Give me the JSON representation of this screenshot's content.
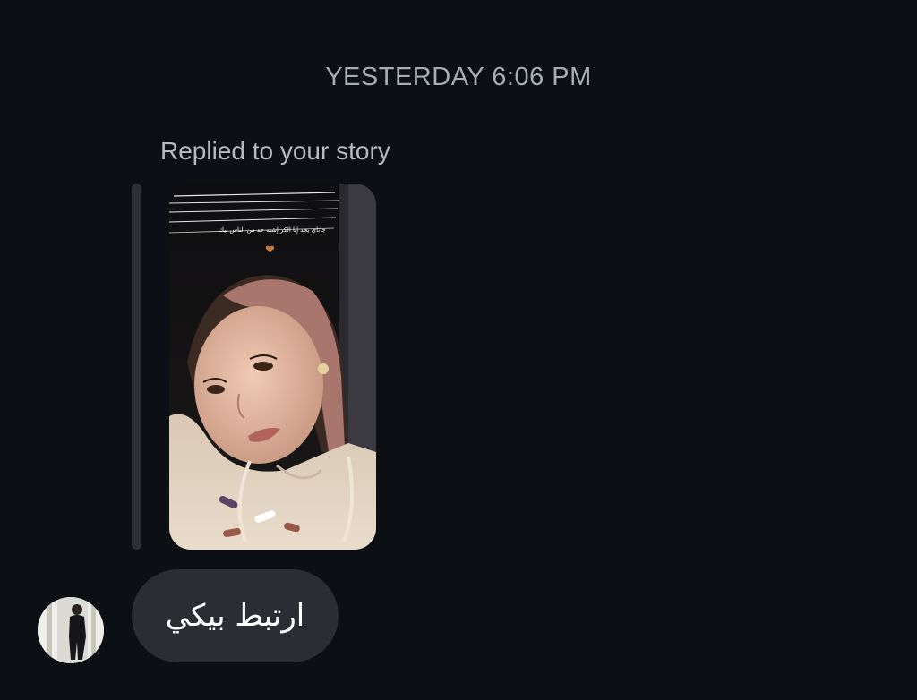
{
  "thread": {
    "timestamp": "YESTERDAY 6:06 PM",
    "reply_label": "Replied to your story"
  },
  "story": {
    "caption": "جاتاي يجد إنا الكر إشبه حد من الناس بيك",
    "heart_icon": "heart-icon",
    "colors": {
      "bar": "#2c3036",
      "background": "#1a1616"
    }
  },
  "message": {
    "text": "ارتبط بيكي",
    "bubble_color": "#2a2d32"
  },
  "sender": {
    "avatar_icon": "avatar"
  }
}
